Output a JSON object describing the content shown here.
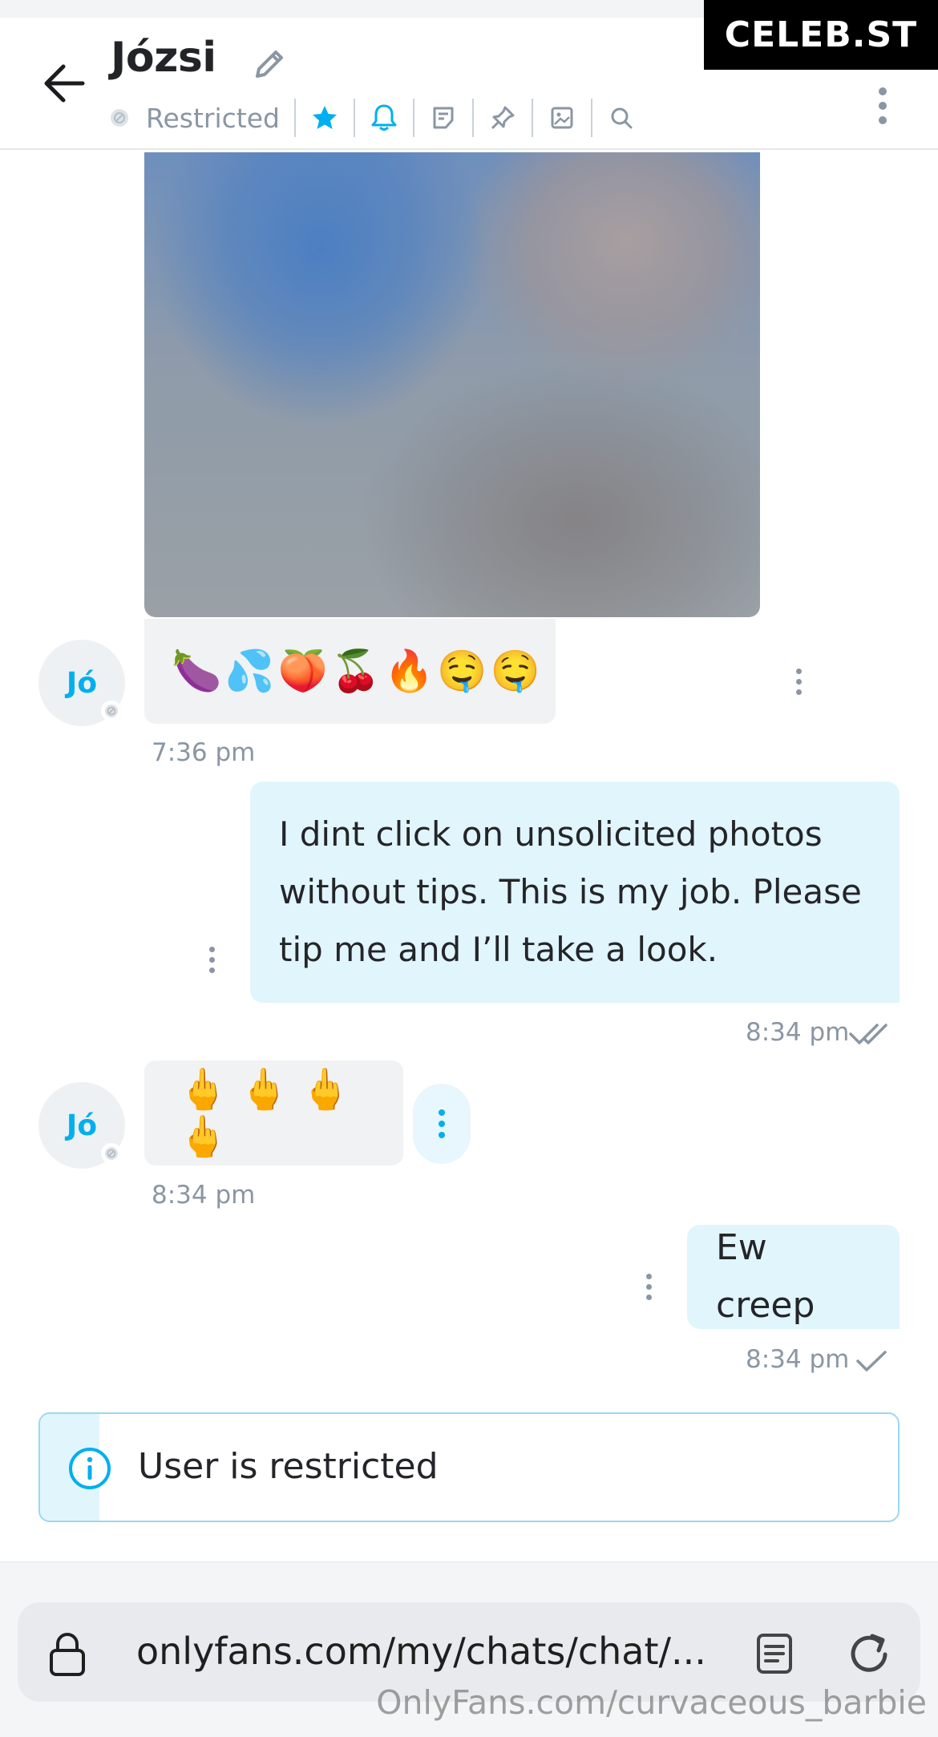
{
  "watermark": {
    "top": "CELEB.ST",
    "bottom": "OnlyFans.com/curvaceous_barbie"
  },
  "header": {
    "title": "Józsi",
    "status": "Restricted",
    "toolbar_icons": [
      "star-icon",
      "bell-icon",
      "note-icon",
      "pin-icon",
      "gallery-icon",
      "search-icon"
    ],
    "accent": "#00aff0"
  },
  "messages": [
    {
      "side": "in",
      "type": "photo",
      "blurred": true
    },
    {
      "side": "in",
      "avatar": "Jó",
      "text": "🍆💦🍑🍒🔥🤤🤤",
      "time": "7:36 pm"
    },
    {
      "side": "out",
      "lines": [
        "I dint click on unsolicited photos",
        "without tips. This is my job. Please",
        "tip me and I’ll take a look."
      ],
      "time": "8:34 pm",
      "status": "read"
    },
    {
      "side": "in",
      "avatar": "Jó",
      "text": "🖕🖕🖕🖕",
      "time": "8:34 pm"
    },
    {
      "side": "out",
      "text": "Ew creep",
      "time": "8:34 pm",
      "status": "sent"
    }
  ],
  "notice": {
    "text": "User is restricted",
    "icon": "info-icon"
  },
  "browser": {
    "url": "onlyfans.com/my/chats/chat/..."
  }
}
